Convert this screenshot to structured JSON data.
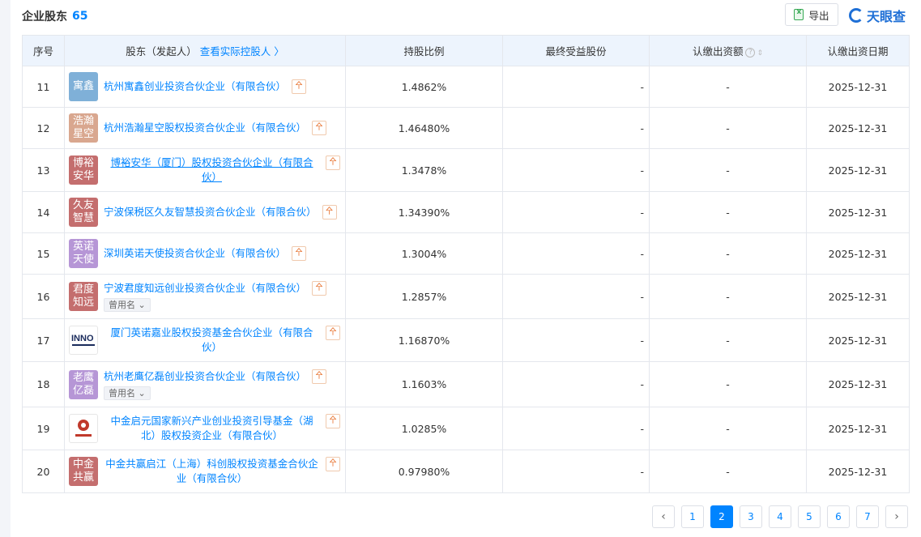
{
  "header": {
    "title": "企业股东",
    "count": "65"
  },
  "toolbar": {
    "export_label": "导出",
    "logo_text": "天眼查"
  },
  "table": {
    "columns": {
      "index": "序号",
      "shareholder": "股东（发起人）",
      "controller_link": "查看实际控股人 〉",
      "ratio": "持股比例",
      "final_benefit": "最终受益股份",
      "capital": "认缴出资额",
      "date": "认缴出资日期"
    },
    "used_name_label": "曾用名",
    "rows": [
      {
        "idx": "11",
        "avatar": "寓鑫",
        "avatar_color": "#7fb0d8",
        "name": "杭州寓鑫创业投资合伙企业（有限合伙）",
        "ratio": "1.4862%",
        "final": "-",
        "capital": "-",
        "date": "2025-12-31"
      },
      {
        "idx": "12",
        "avatar": "浩瀚星空",
        "avatar_color": "#d9a78f",
        "name": "杭州浩瀚星空股权投资合伙企业（有限合伙）",
        "ratio": "1.46480%",
        "final": "-",
        "capital": "-",
        "date": "2025-12-31"
      },
      {
        "idx": "13",
        "avatar": "博裕安华",
        "avatar_color": "#c46e6e",
        "name": "博裕安华（厦门）股权投资合伙企业（有限合伙）",
        "ratio": "1.3478%",
        "final": "-",
        "capital": "-",
        "date": "2025-12-31"
      },
      {
        "idx": "14",
        "avatar": "久友智慧",
        "avatar_color": "#c46e6e",
        "name": "宁波保税区久友智慧投资合伙企业（有限合伙）",
        "ratio": "1.34390%",
        "final": "-",
        "capital": "-",
        "date": "2025-12-31"
      },
      {
        "idx": "15",
        "avatar": "英诺天使",
        "avatar_color": "#b696d6",
        "name": "深圳英诺天使投资合伙企业（有限合伙）",
        "ratio": "1.3004%",
        "final": "-",
        "capital": "-",
        "date": "2025-12-31"
      },
      {
        "idx": "16",
        "avatar": "君度知远",
        "avatar_color": "#c46e6e",
        "name": "宁波君度知远创业投资合伙企业（有限合伙）",
        "ratio": "1.2857%",
        "final": "-",
        "capital": "-",
        "date": "2025-12-31"
      },
      {
        "idx": "17",
        "avatar": "INNO",
        "avatar_color": "#ffffff",
        "name": "厦门英诺嘉业股权投资基金合伙企业（有限合伙）",
        "ratio": "1.16870%",
        "final": "-",
        "capital": "-",
        "date": "2025-12-31"
      },
      {
        "idx": "18",
        "avatar": "老鹰亿磊",
        "avatar_color": "#b696d6",
        "name": "杭州老鹰亿磊创业投资合伙企业（有限合伙）",
        "ratio": "1.1603%",
        "final": "-",
        "capital": "-",
        "date": "2025-12-31"
      },
      {
        "idx": "19",
        "avatar": "中金启元",
        "avatar_color": "#ffffff",
        "name": "中金启元国家新兴产业创业投资引导基金（湖北）股权投资企业（有限合伙）",
        "ratio": "1.0285%",
        "final": "-",
        "capital": "-",
        "date": "2025-12-31"
      },
      {
        "idx": "20",
        "avatar": "中金共赢",
        "avatar_color": "#c46e6e",
        "name": "中金共赢启江（上海）科创股权投资基金合伙企业（有限合伙）",
        "ratio": "0.97980%",
        "final": "-",
        "capital": "-",
        "date": "2025-12-31"
      }
    ]
  },
  "pagination": {
    "prev": "‹",
    "next": "›",
    "pages": [
      "1",
      "2",
      "3",
      "4",
      "5",
      "6",
      "7"
    ]
  }
}
